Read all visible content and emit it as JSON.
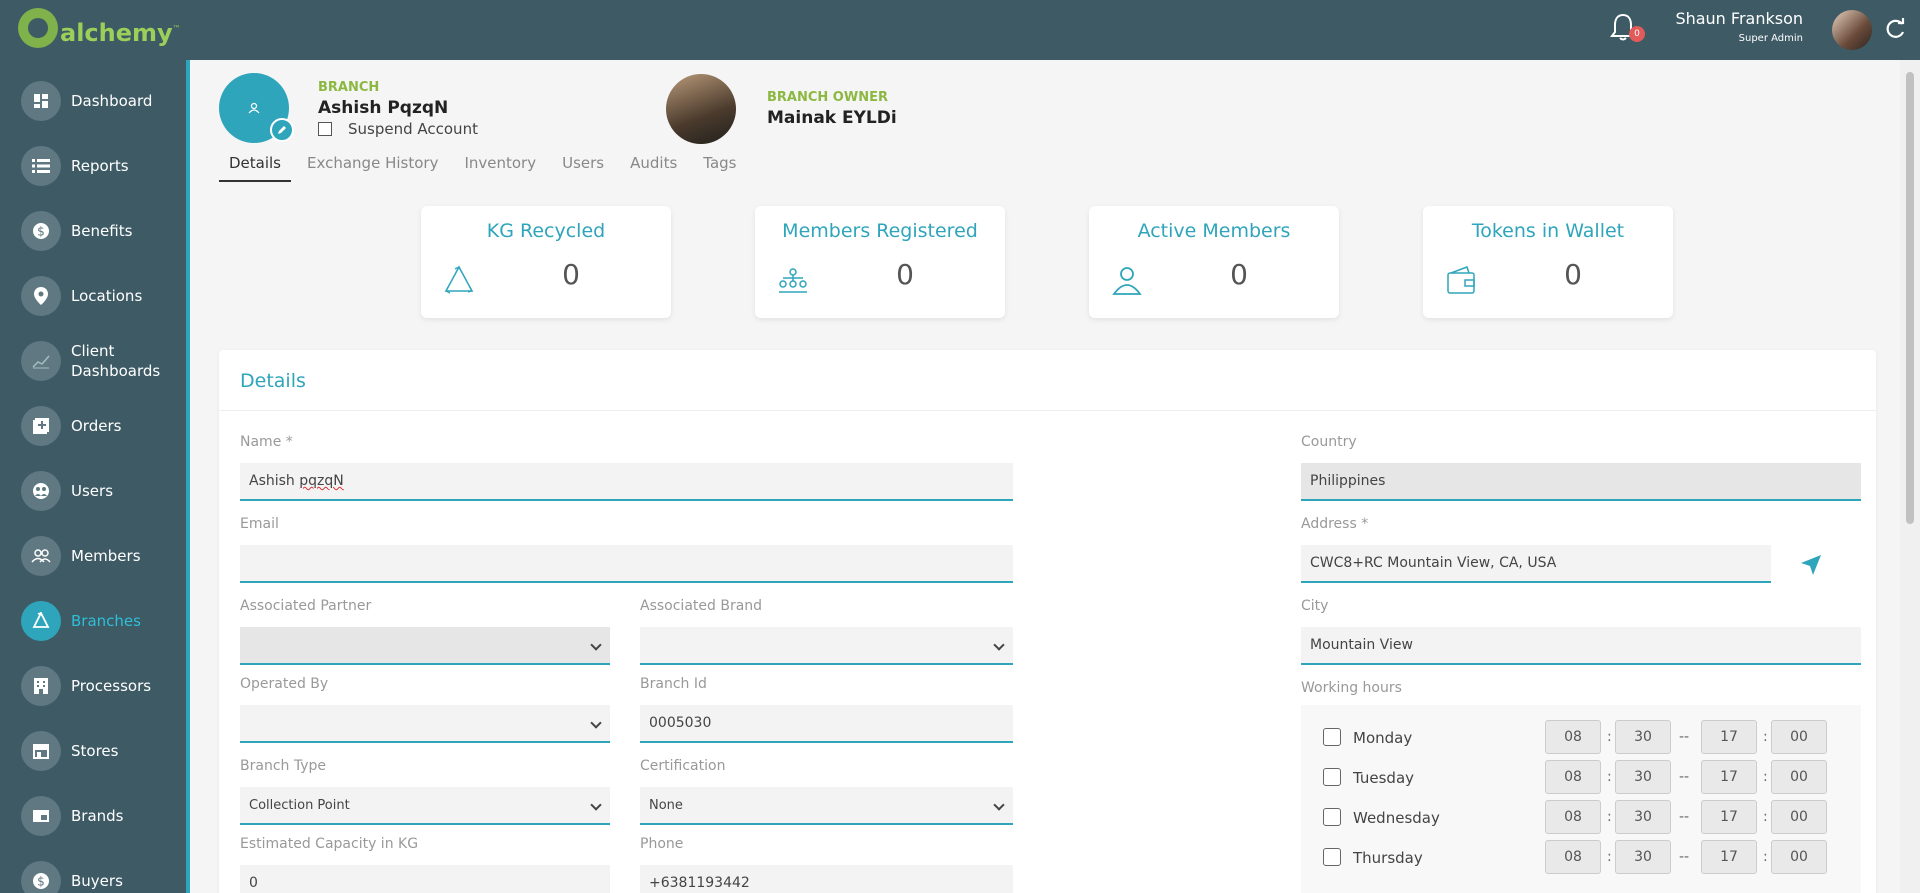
{
  "app": {
    "brand": "alchemy",
    "trademark": "™"
  },
  "header": {
    "notification_count": "0",
    "user_name": "Shaun Frankson",
    "user_role": "Super Admin"
  },
  "sidebar": {
    "items": [
      {
        "label": "Dashboard",
        "icon": "dashboard-icon"
      },
      {
        "label": "Reports",
        "icon": "list-icon"
      },
      {
        "label": "Benefits",
        "icon": "dollar-icon"
      },
      {
        "label": "Locations",
        "icon": "location-pin-icon"
      },
      {
        "label": "Client",
        "label2": "Dashboards",
        "icon": "chart-icon"
      },
      {
        "label": "Orders",
        "icon": "add-box-icon"
      },
      {
        "label": "Users",
        "icon": "users-icon"
      },
      {
        "label": "Members",
        "icon": "members-icon"
      },
      {
        "label": "Branches",
        "icon": "recycle-icon",
        "active": true
      },
      {
        "label": "Processors",
        "icon": "building-icon"
      },
      {
        "label": "Stores",
        "icon": "store-icon"
      },
      {
        "label": "Brands",
        "icon": "tag-icon"
      },
      {
        "label": "Buyers",
        "icon": "dollar-icon"
      }
    ]
  },
  "branch": {
    "label": "BRANCH",
    "name": "Ashish PqzqN",
    "suspend_label": "Suspend Account",
    "owner_label": "BRANCH OWNER",
    "owner_name": "Mainak EYLDi"
  },
  "tabs": [
    "Details",
    "Exchange History",
    "Inventory",
    "Users",
    "Audits",
    "Tags"
  ],
  "stats": [
    {
      "title": "KG Recycled",
      "value": "0",
      "icon": "recycle-icon"
    },
    {
      "title": "Members Registered",
      "value": "0",
      "icon": "hierarchy-icon"
    },
    {
      "title": "Active Members",
      "value": "0",
      "icon": "person-icon"
    },
    {
      "title": "Tokens in Wallet",
      "value": "0",
      "icon": "wallet-icon"
    }
  ],
  "details": {
    "title": "Details",
    "name_label": "Name *",
    "name_value_a": "Ashish ",
    "name_value_b": "pqzqN",
    "email_label": "Email",
    "email_value": "",
    "partner_label": "Associated Partner",
    "partner_value": "",
    "brand_label": "Associated Brand",
    "brand_value": "",
    "operated_label": "Operated By",
    "operated_value": "",
    "branch_id_label": "Branch Id",
    "branch_id_value": "0005030",
    "branch_type_label": "Branch Type",
    "branch_type_value": "Collection Point",
    "cert_label": "Certification",
    "cert_value": "None",
    "capacity_label": "Estimated Capacity in KG",
    "capacity_value": "0",
    "phone_label": "Phone",
    "phone_value": "+6381193442",
    "country_label": "Country",
    "country_value": "Philippines",
    "address_label": "Address *",
    "address_value": "CWC8+RC Mountain View, CA, USA",
    "city_label": "City",
    "city_value": "Mountain View",
    "hours_label": "Working hours",
    "days": [
      {
        "name": "Monday",
        "open_h": "08",
        "open_m": "30",
        "close_h": "17",
        "close_m": "00"
      },
      {
        "name": "Tuesday",
        "open_h": "08",
        "open_m": "30",
        "close_h": "17",
        "close_m": "00"
      },
      {
        "name": "Wednesday",
        "open_h": "08",
        "open_m": "30",
        "close_h": "17",
        "close_m": "00"
      },
      {
        "name": "Thursday",
        "open_h": "08",
        "open_m": "30",
        "close_h": "17",
        "close_m": "00"
      }
    ],
    "colon": ":",
    "dash": "--"
  },
  "colors": {
    "header": "#3d5a65",
    "accent": "#2fa5bb",
    "branch_label": "#8cb842"
  }
}
